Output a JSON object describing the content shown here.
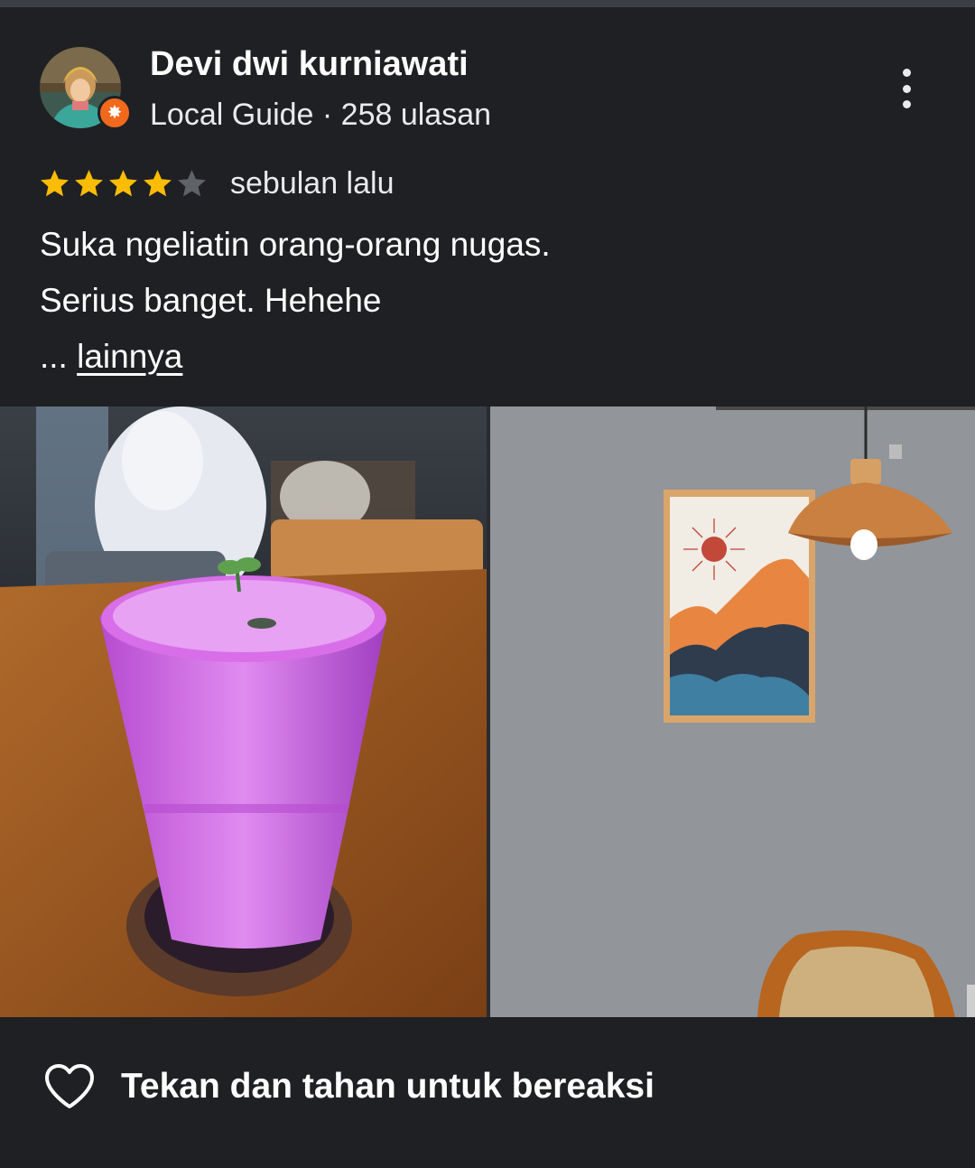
{
  "review": {
    "author_name": "Devi dwi kurniawati",
    "author_meta": "Local Guide · 258 ulasan",
    "rating": 4,
    "rating_max": 5,
    "time": "sebulan lalu",
    "text_lines": [
      "Suka ngeliatin orang-orang nugas.",
      "Serius banget. Hehehe"
    ],
    "ellipsis": "...",
    "more_label": "lainnya"
  },
  "photos": [
    {
      "icon": "dragon-fruit-smoothie-photo"
    },
    {
      "icon": "wall-art-pendant-lamp-photo"
    }
  ],
  "reaction": {
    "label": "Tekan dan tahan untuk bereaksi",
    "icon": "heart-outline-icon"
  },
  "colors": {
    "background": "#1f2024",
    "star_filled": "#fbbc04",
    "star_empty": "#5f6368",
    "local_guide_badge": "#f1691c",
    "text": "#ffffff"
  }
}
